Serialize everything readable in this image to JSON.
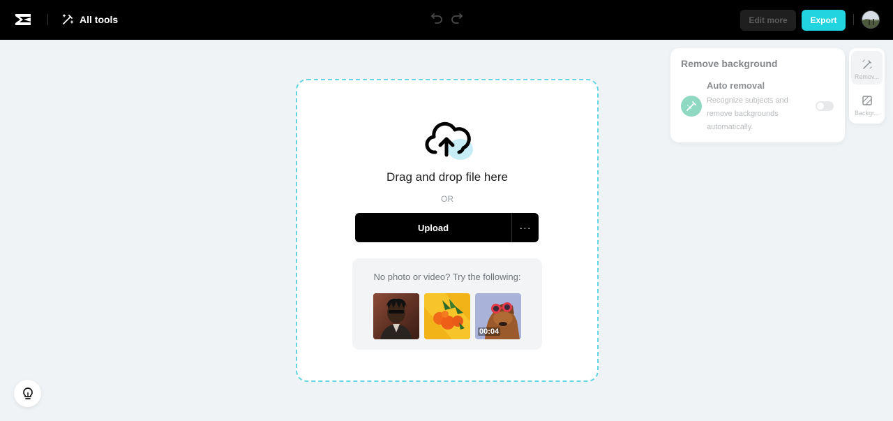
{
  "header": {
    "all_tools_label": "All tools",
    "edit_more_label": "Edit more",
    "export_label": "Export"
  },
  "upload": {
    "drag_text": "Drag and drop file here",
    "or_text": "OR",
    "upload_label": "Upload",
    "more_label": "···",
    "samples_text": "No photo or video? Try the following:",
    "samples": [
      {
        "kind": "photo",
        "icon": "portrait-thumbnail"
      },
      {
        "kind": "photo",
        "icon": "oranges-thumbnail"
      },
      {
        "kind": "video",
        "icon": "dog-thumbnail",
        "duration": "00:04"
      }
    ]
  },
  "panel": {
    "title": "Remove background",
    "auto_title": "Auto removal",
    "auto_desc": "Recognize subjects and remove backgrounds automatically.",
    "toggle_on": false
  },
  "rail": {
    "items": [
      {
        "label": "Remov...",
        "icon": "remove-bg-icon",
        "active": true
      },
      {
        "label": "Backgr...",
        "icon": "background-icon",
        "active": false
      }
    ]
  },
  "colors": {
    "accent": "#22d4e0",
    "dashed_border": "#63d4e2",
    "auto_icon_bg": "#8fd9c2"
  }
}
